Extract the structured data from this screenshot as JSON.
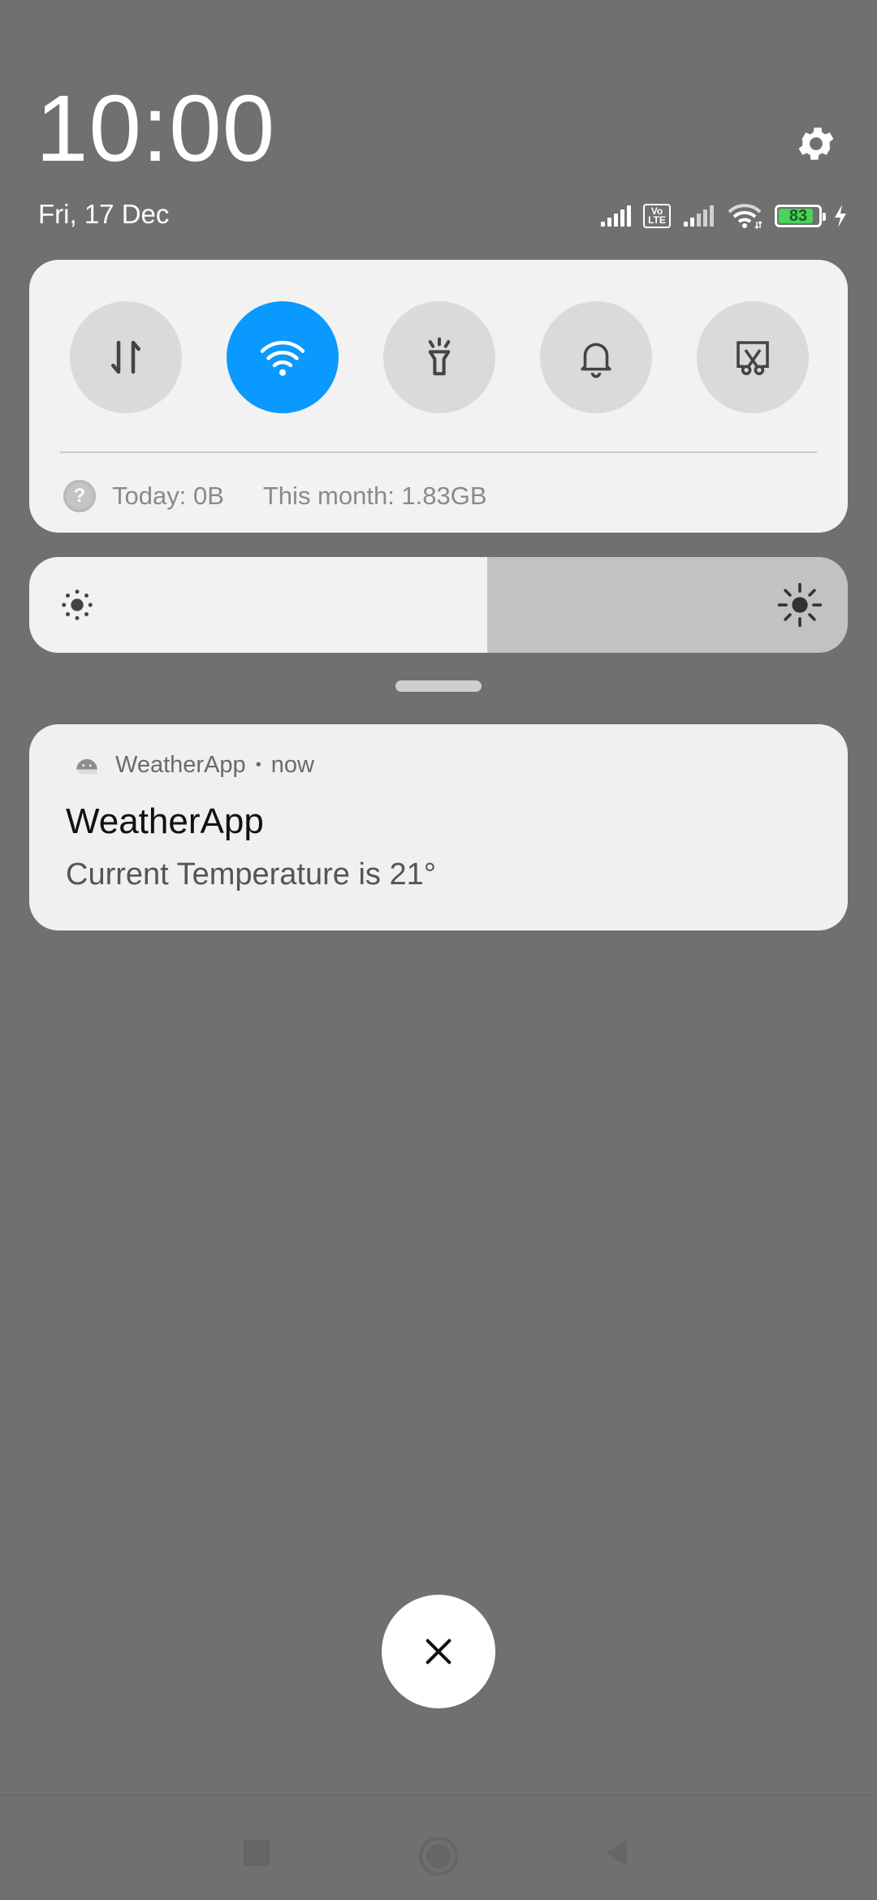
{
  "header": {
    "time": "10:00",
    "date": "Fri, 17 Dec",
    "settings_icon": "gear-icon"
  },
  "status_bar": {
    "volte_top": "Vo",
    "volte_bottom": "LTE",
    "battery_level": "83",
    "icons": [
      "signal-strength-icon",
      "volte-icon",
      "signal-strength-icon",
      "wifi-icon",
      "battery-icon",
      "charging-bolt-icon"
    ]
  },
  "quick_settings": {
    "toggles": [
      {
        "name": "mobile-data",
        "icon": "data-transfer-icon",
        "active": false
      },
      {
        "name": "wifi",
        "icon": "wifi-icon",
        "active": true
      },
      {
        "name": "flashlight",
        "icon": "flashlight-icon",
        "active": false
      },
      {
        "name": "sound",
        "icon": "bell-icon",
        "active": false
      },
      {
        "name": "screenshot",
        "icon": "screenshot-icon",
        "active": false
      }
    ],
    "data_usage": {
      "today": "Today: 0B",
      "month": "This month: 1.83GB",
      "help_glyph": "?"
    }
  },
  "brightness": {
    "level": 0.56
  },
  "notification": {
    "app_name": "WeatherApp",
    "separator": "•",
    "time": "now",
    "title": "WeatherApp",
    "body": "Current Temperature is 21°"
  },
  "colors": {
    "background": "#707070",
    "panel": "#f2f2f2",
    "accent": "#0a99ff",
    "toggle_inactive": "#dadada",
    "battery_fill": "#49d35b"
  }
}
